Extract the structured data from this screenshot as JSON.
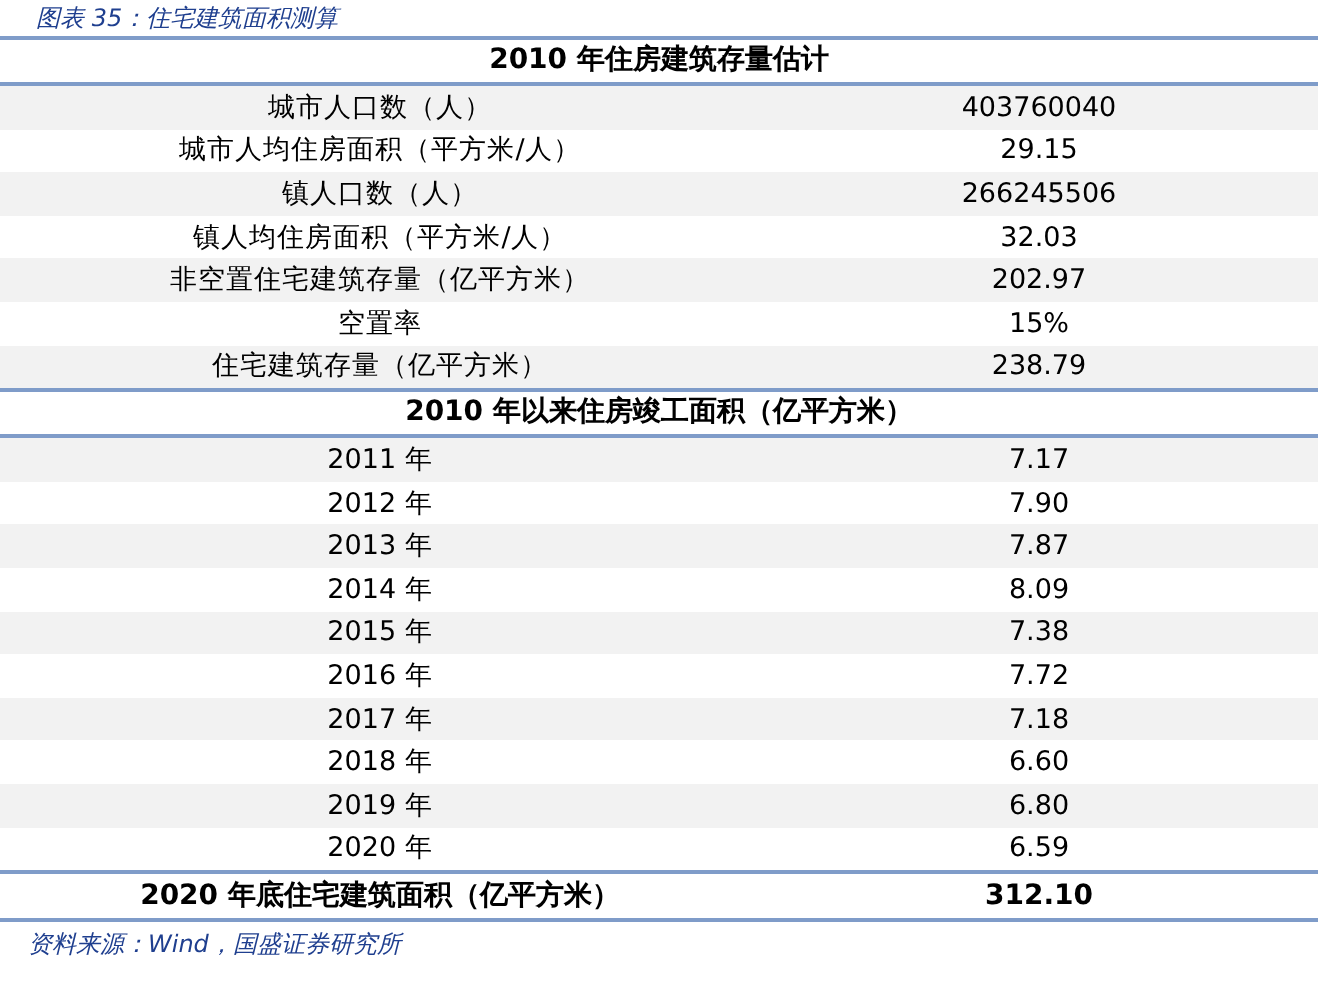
{
  "caption": "图表 35：住宅建筑面积测算",
  "sections": [
    {
      "title": "2010 年住房建筑存量估计",
      "rows": [
        {
          "label": "城市人口数（人）",
          "value": "403760040"
        },
        {
          "label": "城市人均住房面积（平方米/人）",
          "value": "29.15"
        },
        {
          "label": "镇人口数（人）",
          "value": "266245506"
        },
        {
          "label": "镇人均住房面积（平方米/人）",
          "value": "32.03"
        },
        {
          "label": "非空置住宅建筑存量（亿平方米）",
          "value": "202.97"
        },
        {
          "label": "空置率",
          "value": "15%"
        },
        {
          "label": "住宅建筑存量（亿平方米）",
          "value": "238.79"
        }
      ]
    },
    {
      "title": "2010 年以来住房竣工面积（亿平方米）",
      "rows": [
        {
          "label": "2011 年",
          "value": "7.17"
        },
        {
          "label": "2012 年",
          "value": "7.90"
        },
        {
          "label": "2013 年",
          "value": "7.87"
        },
        {
          "label": "2014 年",
          "value": "8.09"
        },
        {
          "label": "2015 年",
          "value": "7.38"
        },
        {
          "label": "2016 年",
          "value": "7.72"
        },
        {
          "label": "2017 年",
          "value": "7.18"
        },
        {
          "label": "2018 年",
          "value": "6.60"
        },
        {
          "label": "2019 年",
          "value": "6.80"
        },
        {
          "label": "2020 年",
          "value": "6.59"
        }
      ]
    }
  ],
  "total": {
    "label": "2020 年底住宅建筑面积（亿平方米）",
    "value": "312.10"
  },
  "source": "资料来源：Wind，国盛证券研究所"
}
